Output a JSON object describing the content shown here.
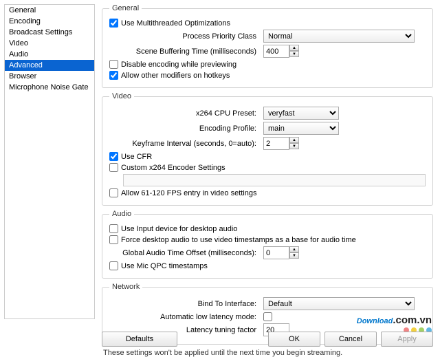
{
  "sidebar": {
    "items": [
      {
        "label": "General"
      },
      {
        "label": "Encoding"
      },
      {
        "label": "Broadcast Settings"
      },
      {
        "label": "Video"
      },
      {
        "label": "Audio"
      },
      {
        "label": "Advanced"
      },
      {
        "label": "Browser"
      },
      {
        "label": "Microphone Noise Gate"
      }
    ]
  },
  "general": {
    "legend": "General",
    "multithread_label": "Use Multithreaded Optimizations",
    "priority_label": "Process Priority Class",
    "priority_value": "Normal",
    "buffer_label": "Scene Buffering Time (milliseconds)",
    "buffer_value": "400",
    "disable_preview_label": "Disable encoding while previewing",
    "allow_modifiers_label": "Allow other modifiers on hotkeys"
  },
  "video": {
    "legend": "Video",
    "preset_label": "x264 CPU Preset:",
    "preset_value": "veryfast",
    "profile_label": "Encoding Profile:",
    "profile_value": "main",
    "keyframe_label": "Keyframe Interval (seconds, 0=auto):",
    "keyframe_value": "2",
    "cfr_label": "Use CFR",
    "custom_label": "Custom x264 Encoder Settings",
    "allow_fps_label": "Allow 61-120 FPS entry in video settings"
  },
  "audio": {
    "legend": "Audio",
    "input_desktop_label": "Use Input device for desktop audio",
    "force_ts_label": "Force desktop audio to use video timestamps as a base for audio time",
    "offset_label": "Global Audio Time Offset (milliseconds):",
    "offset_value": "0",
    "qpc_label": "Use Mic QPC timestamps"
  },
  "network": {
    "legend": "Network",
    "bind_label": "Bind To Interface:",
    "bind_value": "Default",
    "lowlat_label": "Automatic low latency mode:",
    "tuning_label": "Latency tuning factor",
    "tuning_value": "20"
  },
  "note": "These settings won't be applied until the next time you begin streaming.",
  "footer": {
    "defaults": "Defaults",
    "ok": "OK",
    "cancel": "Cancel",
    "apply": "Apply"
  },
  "watermark": {
    "brand": "Download",
    "suffix": ".com.vn"
  }
}
